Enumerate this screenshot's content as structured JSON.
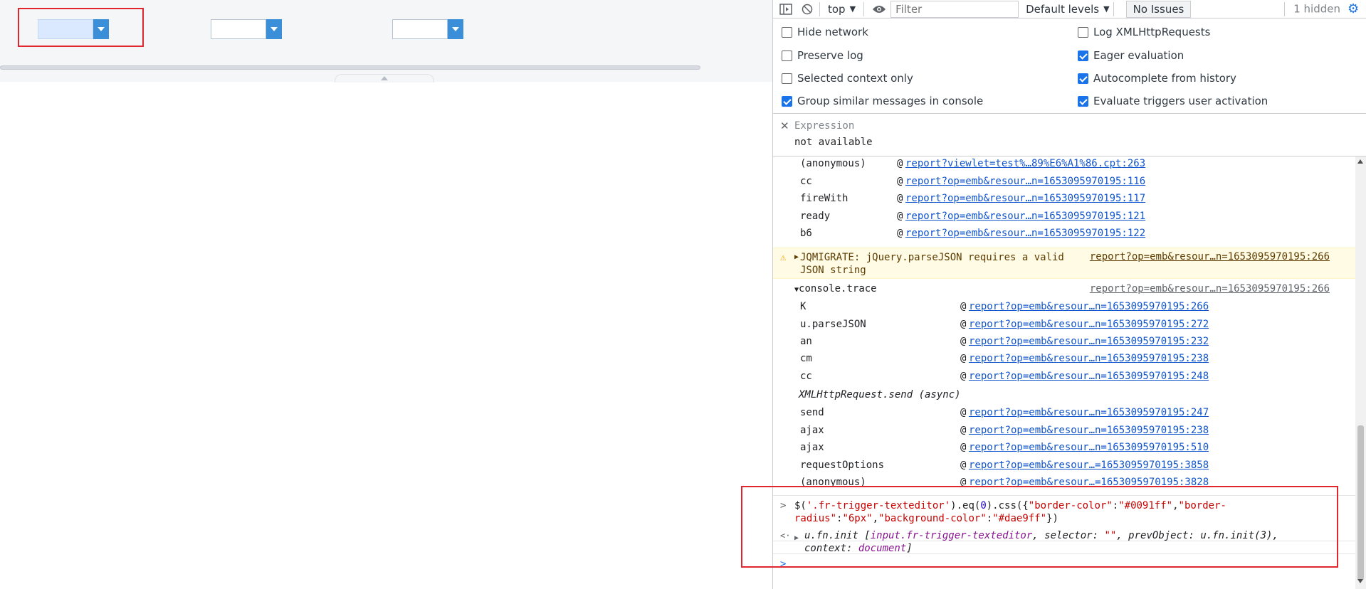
{
  "report": {
    "combos": [
      {
        "name": "combo-1"
      },
      {
        "name": "combo-2"
      },
      {
        "name": "combo-3"
      }
    ]
  },
  "toolbar": {
    "context": "top",
    "filter_placeholder": "Filter",
    "levels": "Default levels",
    "issues": "No Issues",
    "hidden": "1 hidden"
  },
  "settings": {
    "left": [
      {
        "label": "Hide network",
        "checked": false
      },
      {
        "label": "Preserve log",
        "checked": false
      },
      {
        "label": "Selected context only",
        "checked": false
      },
      {
        "label": "Group similar messages in console",
        "checked": true
      }
    ],
    "right": [
      {
        "label": "Log XMLHttpRequests",
        "checked": false
      },
      {
        "label": "Eager evaluation",
        "checked": true
      },
      {
        "label": "Autocomplete from history",
        "checked": true
      },
      {
        "label": "Evaluate triggers user activation",
        "checked": true
      }
    ]
  },
  "expression": {
    "label": "Expression",
    "value": "not available"
  },
  "stack1": [
    {
      "fn": "(anonymous)",
      "at": "@",
      "link": "report?viewlet=test%…89%E6%A1%86.cpt:263"
    },
    {
      "fn": "cc",
      "at": "@",
      "link": "report?op=emb&resour…n=1653095970195:116"
    },
    {
      "fn": "fireWith",
      "at": "@",
      "link": "report?op=emb&resour…n=1653095970195:117"
    },
    {
      "fn": "ready",
      "at": "@",
      "link": "report?op=emb&resour…n=1653095970195:121"
    },
    {
      "fn": "b6",
      "at": "@",
      "link": "report?op=emb&resour…n=1653095970195:122"
    }
  ],
  "warning": {
    "message": "JQMIGRATE: jQuery.parseJSON requires a valid JSON string",
    "source": "report?op=emb&resour…n=1653095970195:266"
  },
  "trace": {
    "title": "console.trace",
    "source": "report?op=emb&resour…n=1653095970195:266",
    "frames": [
      {
        "fn": "K",
        "at": "@",
        "link": "report?op=emb&resour…n=1653095970195:266"
      },
      {
        "fn": "u.parseJSON",
        "at": "@",
        "link": "report?op=emb&resour…n=1653095970195:272"
      },
      {
        "fn": "an",
        "at": "@",
        "link": "report?op=emb&resour…n=1653095970195:232"
      },
      {
        "fn": "cm",
        "at": "@",
        "link": "report?op=emb&resour…n=1653095970195:238"
      },
      {
        "fn": "cc",
        "at": "@",
        "link": "report?op=emb&resour…n=1653095970195:248"
      },
      {
        "fn": "XMLHttpRequest.send (async)",
        "at": "",
        "link": ""
      },
      {
        "fn": "send",
        "at": "@",
        "link": "report?op=emb&resour…n=1653095970195:247"
      },
      {
        "fn": "ajax",
        "at": "@",
        "link": "report?op=emb&resour…n=1653095970195:238"
      },
      {
        "fn": "ajax",
        "at": "@",
        "link": "report?op=emb&resour…n=1653095970195:510"
      },
      {
        "fn": "requestOptions",
        "at": "@",
        "link": "report?op=emb&resour…=1653095970195:3858"
      },
      {
        "fn": "(anonymous)",
        "at": "@",
        "link": "report?op=emb&resour…=1653095970195:3828"
      }
    ]
  },
  "command": {
    "prompt": ">",
    "p1": "$(",
    "s1": "'.fr-trigger-texteditor'",
    "p2": ").eq(",
    "n1": "0",
    "p3": ").css({",
    "s2": "\"border-color\"",
    "p4": ":",
    "s3": "\"#0091ff\"",
    "p5": ",",
    "s4": "\"border-radius\"",
    "p6": ":",
    "s5": "\"6px\"",
    "p7": ",",
    "s6": "\"background-color\"",
    "p8": ":",
    "s7": "\"#dae9ff\"",
    "p9": "})",
    "result_prompt": "<·",
    "result_a": "u.fn.init [",
    "result_b": "input.fr-trigger-texteditor",
    "result_c": ", selector: ",
    "result_d": "\"\"",
    "result_e": ", prevObject: u.fn.init(3), context: ",
    "result_f": "document",
    "result_g": "]",
    "next_prompt": ">"
  },
  "colors": {
    "accent": "#1a73e8",
    "link": "#1155cc",
    "highlight_bg": "#dae9ff",
    "annotation_red": "#e0262c",
    "warning_bg": "#fffbe5"
  }
}
